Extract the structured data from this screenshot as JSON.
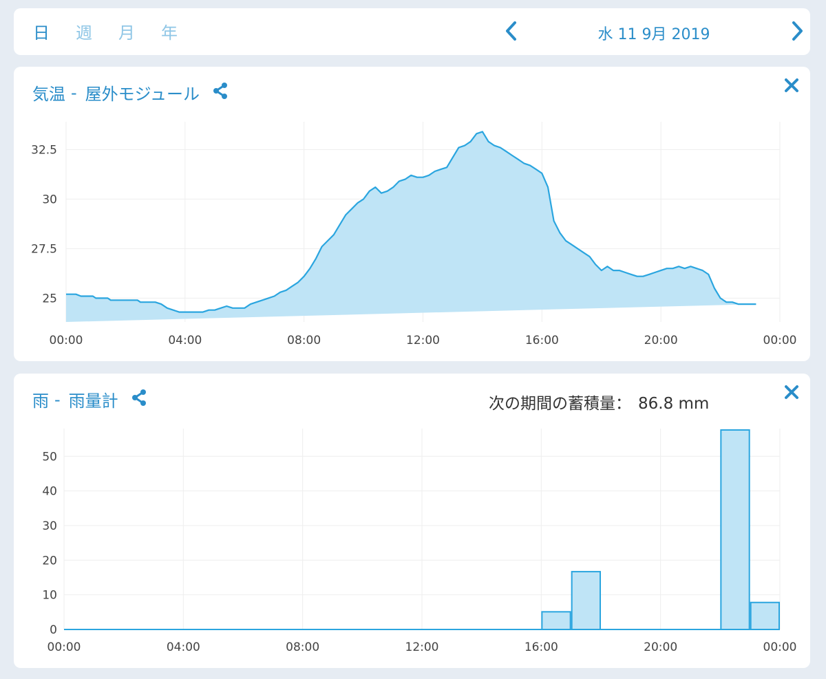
{
  "period_tabs": [
    {
      "label": "日",
      "active": true
    },
    {
      "label": "週",
      "active": false
    },
    {
      "label": "月",
      "active": false
    },
    {
      "label": "年",
      "active": false
    }
  ],
  "date_label": "水 11 9月 2019",
  "colors": {
    "accent": "#2a8dc9",
    "inactive_tab": "#8fc6e6",
    "series_line": "#2aa5df",
    "series_fill": "#bfe4f6",
    "background": "#e6ecf3"
  },
  "temperature_card": {
    "title_main": "気温",
    "title_sep": "-",
    "title_sub": "屋外モジュール"
  },
  "rain_card": {
    "title_main": "雨",
    "title_sep": "-",
    "title_sub": "雨量計",
    "accum_label": "次の期間の蓄積量：",
    "accum_value": "86.8 mm"
  },
  "chart_data": [
    {
      "type": "area",
      "x_ticks": [
        "00:00",
        "04:00",
        "08:00",
        "12:00",
        "16:00",
        "20:00",
        "00:00"
      ],
      "y_ticks": [
        "25",
        "27.5",
        "30",
        "32.5"
      ],
      "ylim": [
        23.8,
        33.9
      ],
      "grid": true,
      "x_hours": [
        0,
        0.33,
        0.5,
        0.9,
        1,
        1.4,
        1.5,
        2,
        2.4,
        2.5,
        3,
        3.2,
        3.4,
        3.6,
        3.8,
        4,
        4.2,
        4.4,
        4.6,
        4.8,
        5,
        5.2,
        5.4,
        5.6,
        5.8,
        6,
        6.2,
        6.4,
        6.6,
        6.8,
        7,
        7.2,
        7.4,
        7.6,
        7.8,
        8,
        8.2,
        8.4,
        8.6,
        8.8,
        9,
        9.2,
        9.4,
        9.6,
        9.8,
        10,
        10.2,
        10.4,
        10.6,
        10.8,
        11,
        11.2,
        11.4,
        11.6,
        11.8,
        12,
        12.2,
        12.4,
        12.6,
        12.8,
        13,
        13.2,
        13.4,
        13.6,
        13.8,
        14,
        14.2,
        14.4,
        14.6,
        14.8,
        15,
        15.2,
        15.4,
        15.6,
        15.8,
        16,
        16.2,
        16.4,
        16.6,
        16.8,
        17,
        17.2,
        17.4,
        17.6,
        17.8,
        18,
        18.2,
        18.4,
        18.6,
        18.8,
        19,
        19.2,
        19.4,
        19.6,
        19.8,
        20,
        20.2,
        20.4,
        20.6,
        20.8,
        21,
        21.2,
        21.4,
        21.6,
        21.8,
        22,
        22.2,
        22.4,
        22.6,
        22.8,
        23,
        23.2,
        23.4,
        23.6,
        23.8,
        23.95
      ],
      "values": [
        25.2,
        25.2,
        25.1,
        25.1,
        25.0,
        25.0,
        24.9,
        24.9,
        24.9,
        24.8,
        24.8,
        24.7,
        24.5,
        24.4,
        24.3,
        24.3,
        24.3,
        24.3,
        24.3,
        24.4,
        24.4,
        24.5,
        24.6,
        24.5,
        24.5,
        24.5,
        24.7,
        24.8,
        24.9,
        25.0,
        25.1,
        25.3,
        25.4,
        25.6,
        25.8,
        26.1,
        26.5,
        27.0,
        27.6,
        27.9,
        28.2,
        28.7,
        29.2,
        29.5,
        29.8,
        30.0,
        30.4,
        30.6,
        30.3,
        30.4,
        30.6,
        30.9,
        31.0,
        31.2,
        31.1,
        31.1,
        31.2,
        31.4,
        31.5,
        31.6,
        32.1,
        32.6,
        32.7,
        32.9,
        33.3,
        33.4,
        32.9,
        32.7,
        32.6,
        32.4,
        32.2,
        32.0,
        31.8,
        31.7,
        31.5,
        31.3,
        30.6,
        28.9,
        28.3,
        27.9,
        27.7,
        27.5,
        27.3,
        27.1,
        26.7,
        26.4,
        26.6,
        26.4,
        26.4,
        26.3,
        26.2,
        26.1,
        26.1,
        26.2,
        26.3,
        26.4,
        26.5,
        26.5,
        26.6,
        26.5,
        26.6,
        26.5,
        26.4,
        26.2,
        25.5,
        25.0,
        24.8,
        24.8,
        24.7,
        24.7,
        24.7,
        24.7
      ]
    },
    {
      "type": "bar",
      "x_ticks": [
        "00:00",
        "04:00",
        "08:00",
        "12:00",
        "16:00",
        "20:00",
        "00:00"
      ],
      "y_ticks": [
        "0",
        "10",
        "20",
        "30",
        "40",
        "50"
      ],
      "ylim": [
        0,
        58
      ],
      "grid": true,
      "categories": [
        "00:00",
        "01:00",
        "02:00",
        "03:00",
        "04:00",
        "05:00",
        "06:00",
        "07:00",
        "08:00",
        "09:00",
        "10:00",
        "11:00",
        "12:00",
        "13:00",
        "14:00",
        "15:00",
        "16:00",
        "17:00",
        "18:00",
        "19:00",
        "20:00",
        "21:00",
        "22:00",
        "23:00"
      ],
      "values": [
        0,
        0,
        0,
        0,
        0,
        0,
        0,
        0,
        0,
        0,
        0,
        0,
        0,
        0,
        0,
        0,
        5.1,
        16.7,
        0,
        0,
        0,
        0,
        57.6,
        7.8
      ]
    }
  ]
}
